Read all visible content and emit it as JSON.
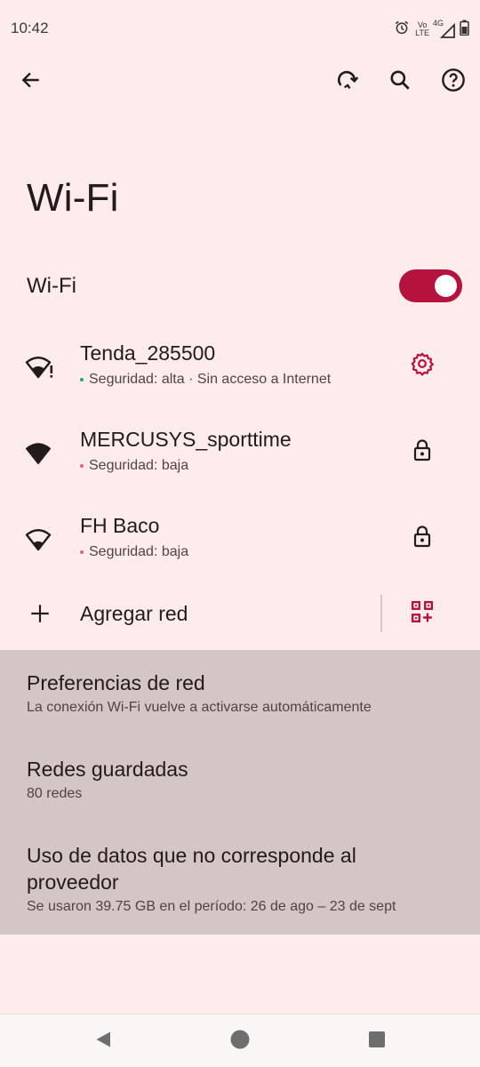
{
  "status_bar": {
    "time": "10:42",
    "volte_top": "Vo",
    "volte_bottom": "LTE",
    "network": "4G",
    "icons": [
      "alarm-icon",
      "volte-icon",
      "signal-icon",
      "battery-icon"
    ]
  },
  "app_bar": {
    "icons": [
      "back-arrow-icon",
      "refresh-icon",
      "search-icon",
      "help-icon"
    ]
  },
  "page": {
    "title": "Wi-Fi"
  },
  "wifi_toggle": {
    "label": "Wi-Fi",
    "enabled": true
  },
  "networks": [
    {
      "name": "Tenda_285500",
      "subtitle": "Seguridad: alta · Sin acceso a Internet",
      "dot_color": "#2e9f6e",
      "action_icon": "gear-icon"
    },
    {
      "name": "MERCUSYS_sporttime",
      "subtitle": "Seguridad: baja",
      "dot_color": "#d46a7a",
      "action_icon": "lock-icon"
    },
    {
      "name": "FH Baco",
      "subtitle": "Seguridad: baja",
      "dot_color": "#d46a7a",
      "action_icon": "lock-icon"
    }
  ],
  "add_network": {
    "label": "Agregar red",
    "icons": [
      "plus-icon",
      "qr-code-icon"
    ]
  },
  "preferences": [
    {
      "title": "Preferencias de red",
      "subtitle": "La conexión Wi-Fi vuelve a activarse automáticamente"
    },
    {
      "title": "Redes guardadas",
      "subtitle": "80 redes"
    },
    {
      "title_line1": "Uso de datos que no corresponde al",
      "title_line2": "proveedor",
      "subtitle": "Se usaron 39.75 GB en el período: 26 de ago – 23 de sept"
    }
  ],
  "colors": {
    "accent": "#b5123e",
    "background": "#fdeceb",
    "panel": "#d5c6c6",
    "secure_dot": "#2e9f6e",
    "weak_dot": "#d46a7a"
  }
}
